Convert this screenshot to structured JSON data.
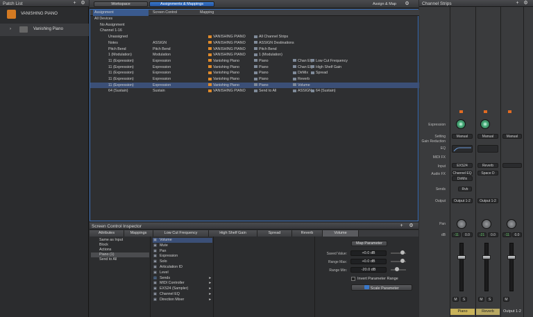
{
  "patch_list": {
    "title": "Patch List",
    "item_header": "VANISHING PIANO",
    "item": "Vanishing Piano"
  },
  "tabs": {
    "workspace": "Workspace",
    "assignments": "Assignments & Mappings",
    "assign_map": "Assign & Map"
  },
  "columns": {
    "assignment": "Assignment",
    "screen_control": "Screen Control",
    "mapping": "Mapping"
  },
  "rows": [
    {
      "a": "All Devices",
      "s": "",
      "m": []
    },
    {
      "a": "No Assignment",
      "s": "",
      "m": []
    },
    {
      "a": "Channel 1-16",
      "s": "",
      "m": []
    },
    {
      "a": "Unassigned",
      "s": "",
      "m": [
        "VANISHING PIANO",
        "All Channel Strips"
      ]
    },
    {
      "a": "Notes",
      "s": "ASSIGN",
      "m": [
        "VANISHING PIANO",
        "ASSIGN Destinations"
      ]
    },
    {
      "a": "Pitch Bend",
      "s": "Pitch Bend",
      "m": [
        "VANISHING PIANO",
        "Pitch Bend"
      ]
    },
    {
      "a": "1 (Modulation)",
      "s": "Modulation",
      "m": [
        "VANISHING PIANO",
        "1 (Modulation)"
      ]
    },
    {
      "a": "11 (Expression)",
      "s": "Expression",
      "m": [
        "Vanishing Piano",
        "Piano",
        "Chan EQ",
        "Low Cut Frequency"
      ]
    },
    {
      "a": "11 (Expression)",
      "s": "Expression",
      "m": [
        "Vanishing Piano",
        "Piano",
        "Chan EQ",
        "High Shelf Gain"
      ]
    },
    {
      "a": "11 (Expression)",
      "s": "Expression",
      "m": [
        "Vanishing Piano",
        "Piano",
        "DirMix",
        "Spread"
      ]
    },
    {
      "a": "11 (Expression)",
      "s": "Expression",
      "m": [
        "Vanishing Piano",
        "Piano",
        "Reverb"
      ]
    },
    {
      "a": "11 (Expression)",
      "s": "Expression",
      "m": [
        "Vanishing Piano",
        "Piano",
        "Volume"
      ]
    },
    {
      "a": "64 (Sustain)",
      "s": "Sustain",
      "m": [
        "VANISHING PIANO",
        "Send to All",
        "ASSIGN",
        "64 (Sustain)"
      ]
    }
  ],
  "inspector": {
    "title": "Screen Control Inspector",
    "tabs": [
      "Attributes",
      "Mappings",
      "Low Cut Frequency",
      "High Shelf Gain",
      "Spread",
      "Reverb",
      "Volume"
    ],
    "col1": [
      "Same as Input",
      "Block",
      "Actions",
      "Piano (1)",
      "Send to All"
    ],
    "col2": [
      "Volume",
      "Mute",
      "Pan",
      "Expression",
      "Solo",
      "Articulation ID",
      "Level",
      "Sends",
      "MIDI Controller",
      "EXS24 (Sampler)",
      "Channel EQ",
      "Direction Mixer"
    ],
    "map_parameter": "Map Parameter",
    "saved_value_label": "Saved Value:",
    "saved_value": "+0.0 dB",
    "range_max_label": "Range Max:",
    "range_max": "+0.0 dB",
    "range_min_label": "Range Min:",
    "range_min": "-20.0 dB",
    "invert": "Invert Parameter Range",
    "scale": "Scale Parameter"
  },
  "strips": {
    "title": "Channel Strips",
    "labels": {
      "expression": "Expression",
      "setting": "Setting",
      "gain_reduction": "Gain Reduction",
      "eq": "EQ",
      "midi_fx": "MIDI FX",
      "input": "Input",
      "audio_fx": "Audio FX",
      "sends": "Sends",
      "output": "Output",
      "pan": "Pan",
      "db": "dB"
    },
    "setting": [
      "Manual",
      "Manual",
      "Manual"
    ],
    "input": [
      "EXS24",
      "Reverb"
    ],
    "audio_fx": [
      "Channel EQ",
      "DirMix",
      "Space D"
    ],
    "send": "Rvb",
    "output": [
      "Output 1-2",
      "Output 1-2"
    ],
    "db": [
      [
        "-11",
        "0.0"
      ],
      [
        "-21",
        "0.0"
      ],
      [
        "-11",
        "0.0"
      ]
    ],
    "names": [
      "Piano",
      "Reverb",
      "Output 1-2"
    ],
    "ms": [
      "M",
      "S"
    ]
  }
}
